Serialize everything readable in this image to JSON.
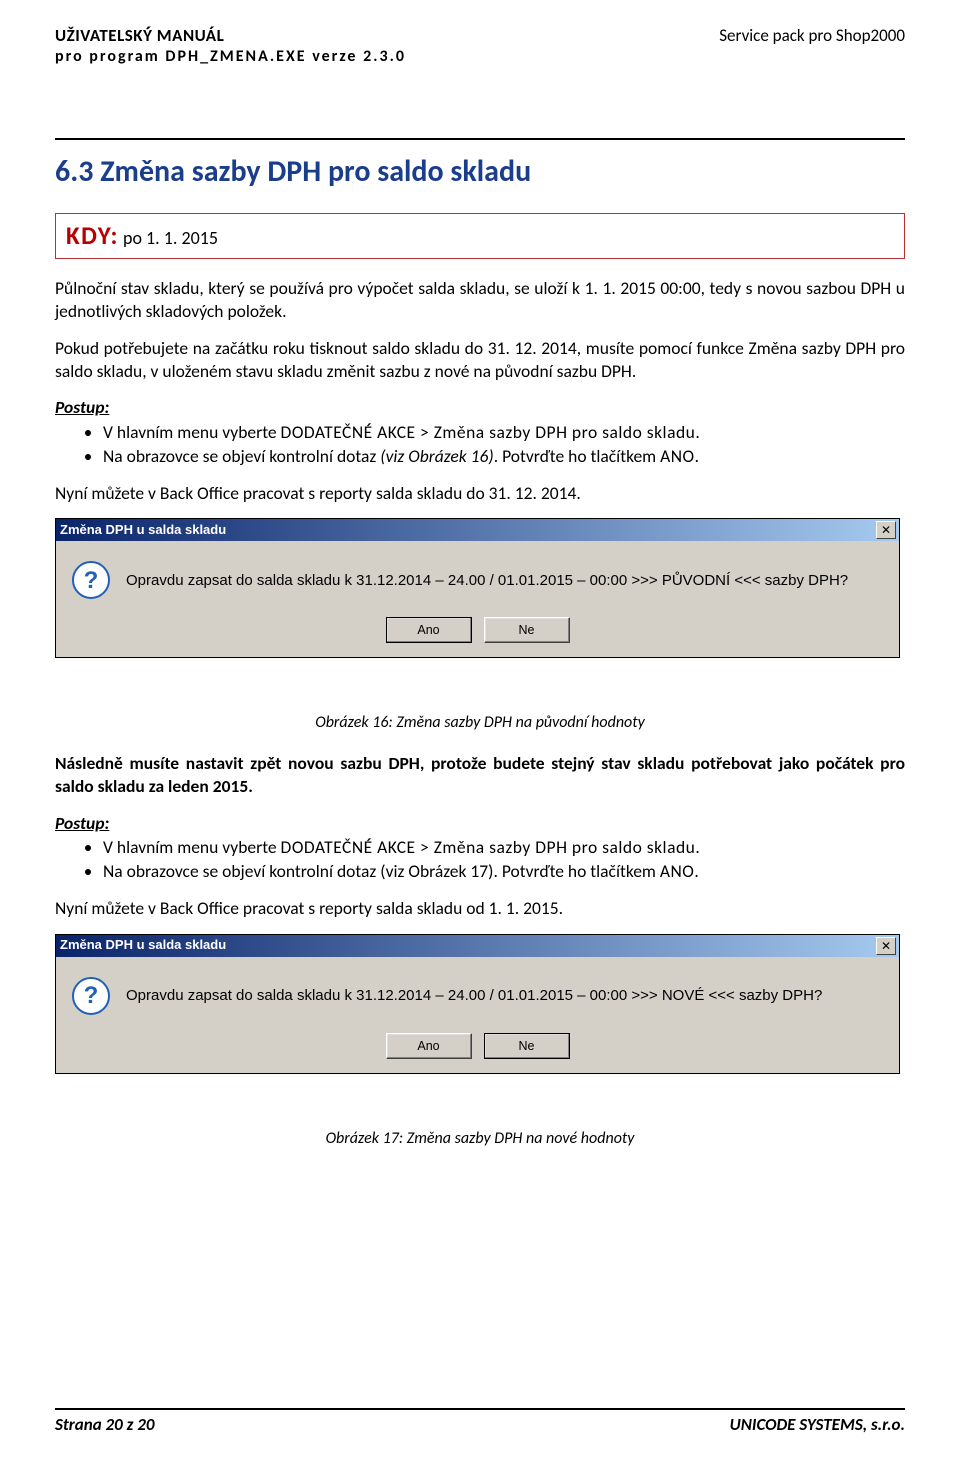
{
  "header": {
    "title_line1": "UŽIVATELSKÝ MANUÁL",
    "title_line2": "pro program DPH_ZMENA.EXE verze 2.3.0",
    "right": "Service pack pro Shop2000"
  },
  "section": {
    "heading": "6.3 Změna sazby DPH pro saldo skladu",
    "kdy_label": "KDY:",
    "kdy_text": " po 1. 1. 2015"
  },
  "para1": "Půlnoční stav skladu, který se používá pro výpočet salda skladu, se uloží k 1. 1. 2015 00:00, tedy s novou sazbou DPH u jednotlivých skladových položek.",
  "para2": "Pokud potřebujete na začátku roku tisknout saldo skladu do 31. 12. 2014, musíte pomocí funkce Změna sazby DPH pro saldo skladu, v uloženém stavu skladu změnit sazbu z nové na původní sazbu DPH.",
  "postup_label": "Postup:",
  "bullets1": {
    "b1_pre": "V hlavním menu vyberte ",
    "b1_path": "DODATEČNÉ AKCE > Změna sazby DPH pro saldo skladu.",
    "b2_pre": "Na obrazovce se objeví kontrolní dotaz ",
    "b2_ref": "(viz Obrázek 16)",
    "b2_post": ". Potvrďte ho tlačítkem ",
    "b2_btn": "ANO",
    "b2_end": "."
  },
  "para3": "Nyní můžete v Back Office pracovat s reporty salda skladu do 31. 12. 2014.",
  "dialog1": {
    "title": "Změna DPH u salda skladu",
    "message": "Opravdu zapsat do salda skladu k 31.12.2014 – 24.00 / 01.01.2015 – 00:00 >>> PŮVODNÍ <<< sazby DPH?",
    "btn_yes": "Ano",
    "btn_no": "Ne"
  },
  "caption1": "Obrázek 16: Změna sazby DPH na původní hodnoty",
  "para4": "Následně musíte nastavit zpět novou sazbu DPH, protože budete stejný stav skladu potřebovat jako počátek pro saldo skladu za leden 2015.",
  "bullets2": {
    "b1_pre": "V hlavním menu vyberte ",
    "b1_path": "DODATEČNÉ AKCE > Změna sazby DPH pro saldo skladu.",
    "b2_pre": "Na obrazovce se objeví kontrolní dotaz (viz Obrázek 17). Potvrďte ho tlačítkem ",
    "b2_btn": "ANO",
    "b2_end": "."
  },
  "para5": "Nyní můžete v Back Office pracovat s reporty salda skladu od 1. 1. 2015.",
  "dialog2": {
    "title": "Změna DPH u salda skladu",
    "message": "Opravdu zapsat do salda skladu k 31.12.2014 – 24.00 / 01.01.2015 – 00:00 >>> NOVÉ <<< sazby DPH?",
    "btn_yes": "Ano",
    "btn_no": "Ne"
  },
  "caption2": "Obrázek 17: Změna sazby DPH na nové hodnoty",
  "footer": {
    "left": "Strana 20 z 20",
    "right": "UNICODE SYSTEMS, s.r.o."
  }
}
